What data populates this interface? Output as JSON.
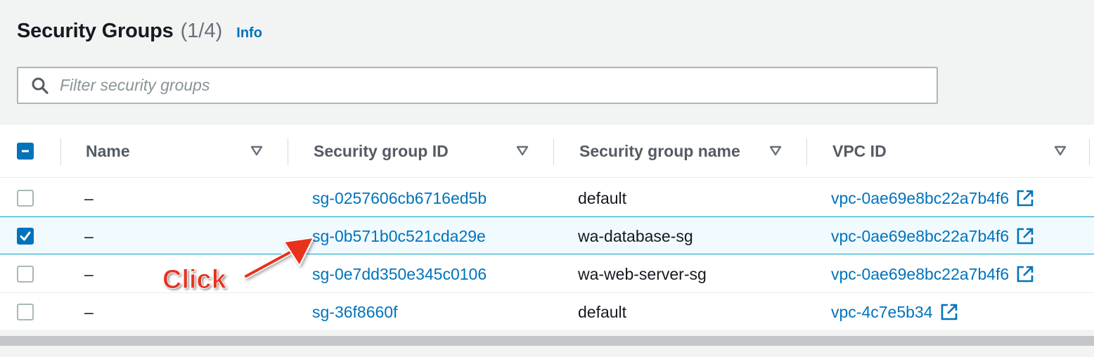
{
  "header": {
    "title": "Security Groups",
    "count": "(1/4)",
    "info_label": "Info"
  },
  "search": {
    "placeholder": "Filter security groups",
    "icon": "search-icon"
  },
  "table": {
    "columns": [
      {
        "label": "Name"
      },
      {
        "label": "Security group ID"
      },
      {
        "label": "Security group name"
      },
      {
        "label": "VPC ID"
      }
    ],
    "rows": [
      {
        "selected": false,
        "name": "–",
        "sg_id": "sg-0257606cb6716ed5b",
        "sg_name": "default",
        "vpc_id": "vpc-0ae69e8bc22a7b4f6"
      },
      {
        "selected": true,
        "name": "–",
        "sg_id": "sg-0b571b0c521cda29e",
        "sg_name": "wa-database-sg",
        "vpc_id": "vpc-0ae69e8bc22a7b4f6"
      },
      {
        "selected": false,
        "name": "–",
        "sg_id": "sg-0e7dd350e345c0106",
        "sg_name": "wa-web-server-sg",
        "vpc_id": "vpc-0ae69e8bc22a7b4f6"
      },
      {
        "selected": false,
        "name": "–",
        "sg_id": "sg-36f8660f",
        "sg_name": "default",
        "vpc_id": "vpc-4c7e5b34"
      }
    ]
  },
  "annotation": {
    "label": "Click",
    "color": "#e8321f"
  },
  "colors": {
    "link": "#0073bb",
    "accent": "#0073bb",
    "selected_row_bg": "#f1faff",
    "selected_row_border": "#00a1c9"
  }
}
